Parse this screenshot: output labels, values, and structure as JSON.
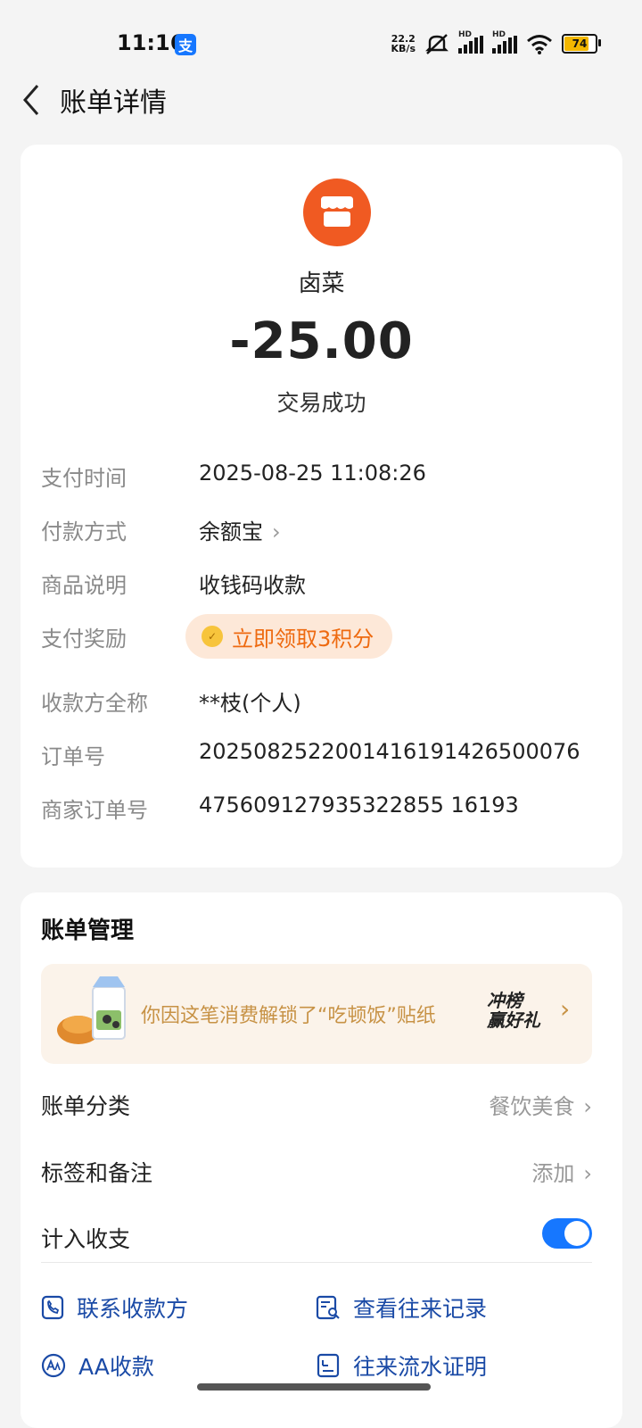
{
  "status_bar": {
    "time": "11:16",
    "app_badge": "支",
    "net_speed_top": "22.2",
    "net_speed_bottom": "KB/s",
    "signal_label": "HD",
    "battery": "74"
  },
  "nav": {
    "back_icon": "chevron-left",
    "title": "账单详情"
  },
  "transaction": {
    "merchant_icon": "store-icon",
    "merchant_name": "卤菜",
    "amount": "-25.00",
    "status": "交易成功"
  },
  "details": [
    {
      "label": "支付时间",
      "value": "2025-08-25 11:08:26"
    },
    {
      "label": "付款方式",
      "value": "余额宝"
    },
    {
      "label": "商品说明",
      "value": "收钱码收款"
    },
    {
      "label": "支付奖励",
      "value": "立即领取3积分"
    },
    {
      "label": "收款方全称",
      "value": "**枝(个人)"
    },
    {
      "label": "订单号",
      "value": "2025082522001416191426500076"
    },
    {
      "label": "商家订单号",
      "value": "475609127935322855 16193"
    }
  ],
  "manage": {
    "title": "账单管理",
    "banner_text": "你因这笔消费解锁了“吃顿饭”贴纸",
    "banner_badge_line1": "冲榜",
    "banner_badge_line2": "赢好礼",
    "category_label": "账单分类",
    "category_value": "餐饮美食",
    "tags_label": "标签和备注",
    "tags_value": "添加",
    "include_label": "计入收支",
    "include_on": true,
    "actions": {
      "contact": "联系收款方",
      "history": "查看往来记录",
      "aa": "AA收款",
      "proof": "往来流水证明"
    }
  }
}
